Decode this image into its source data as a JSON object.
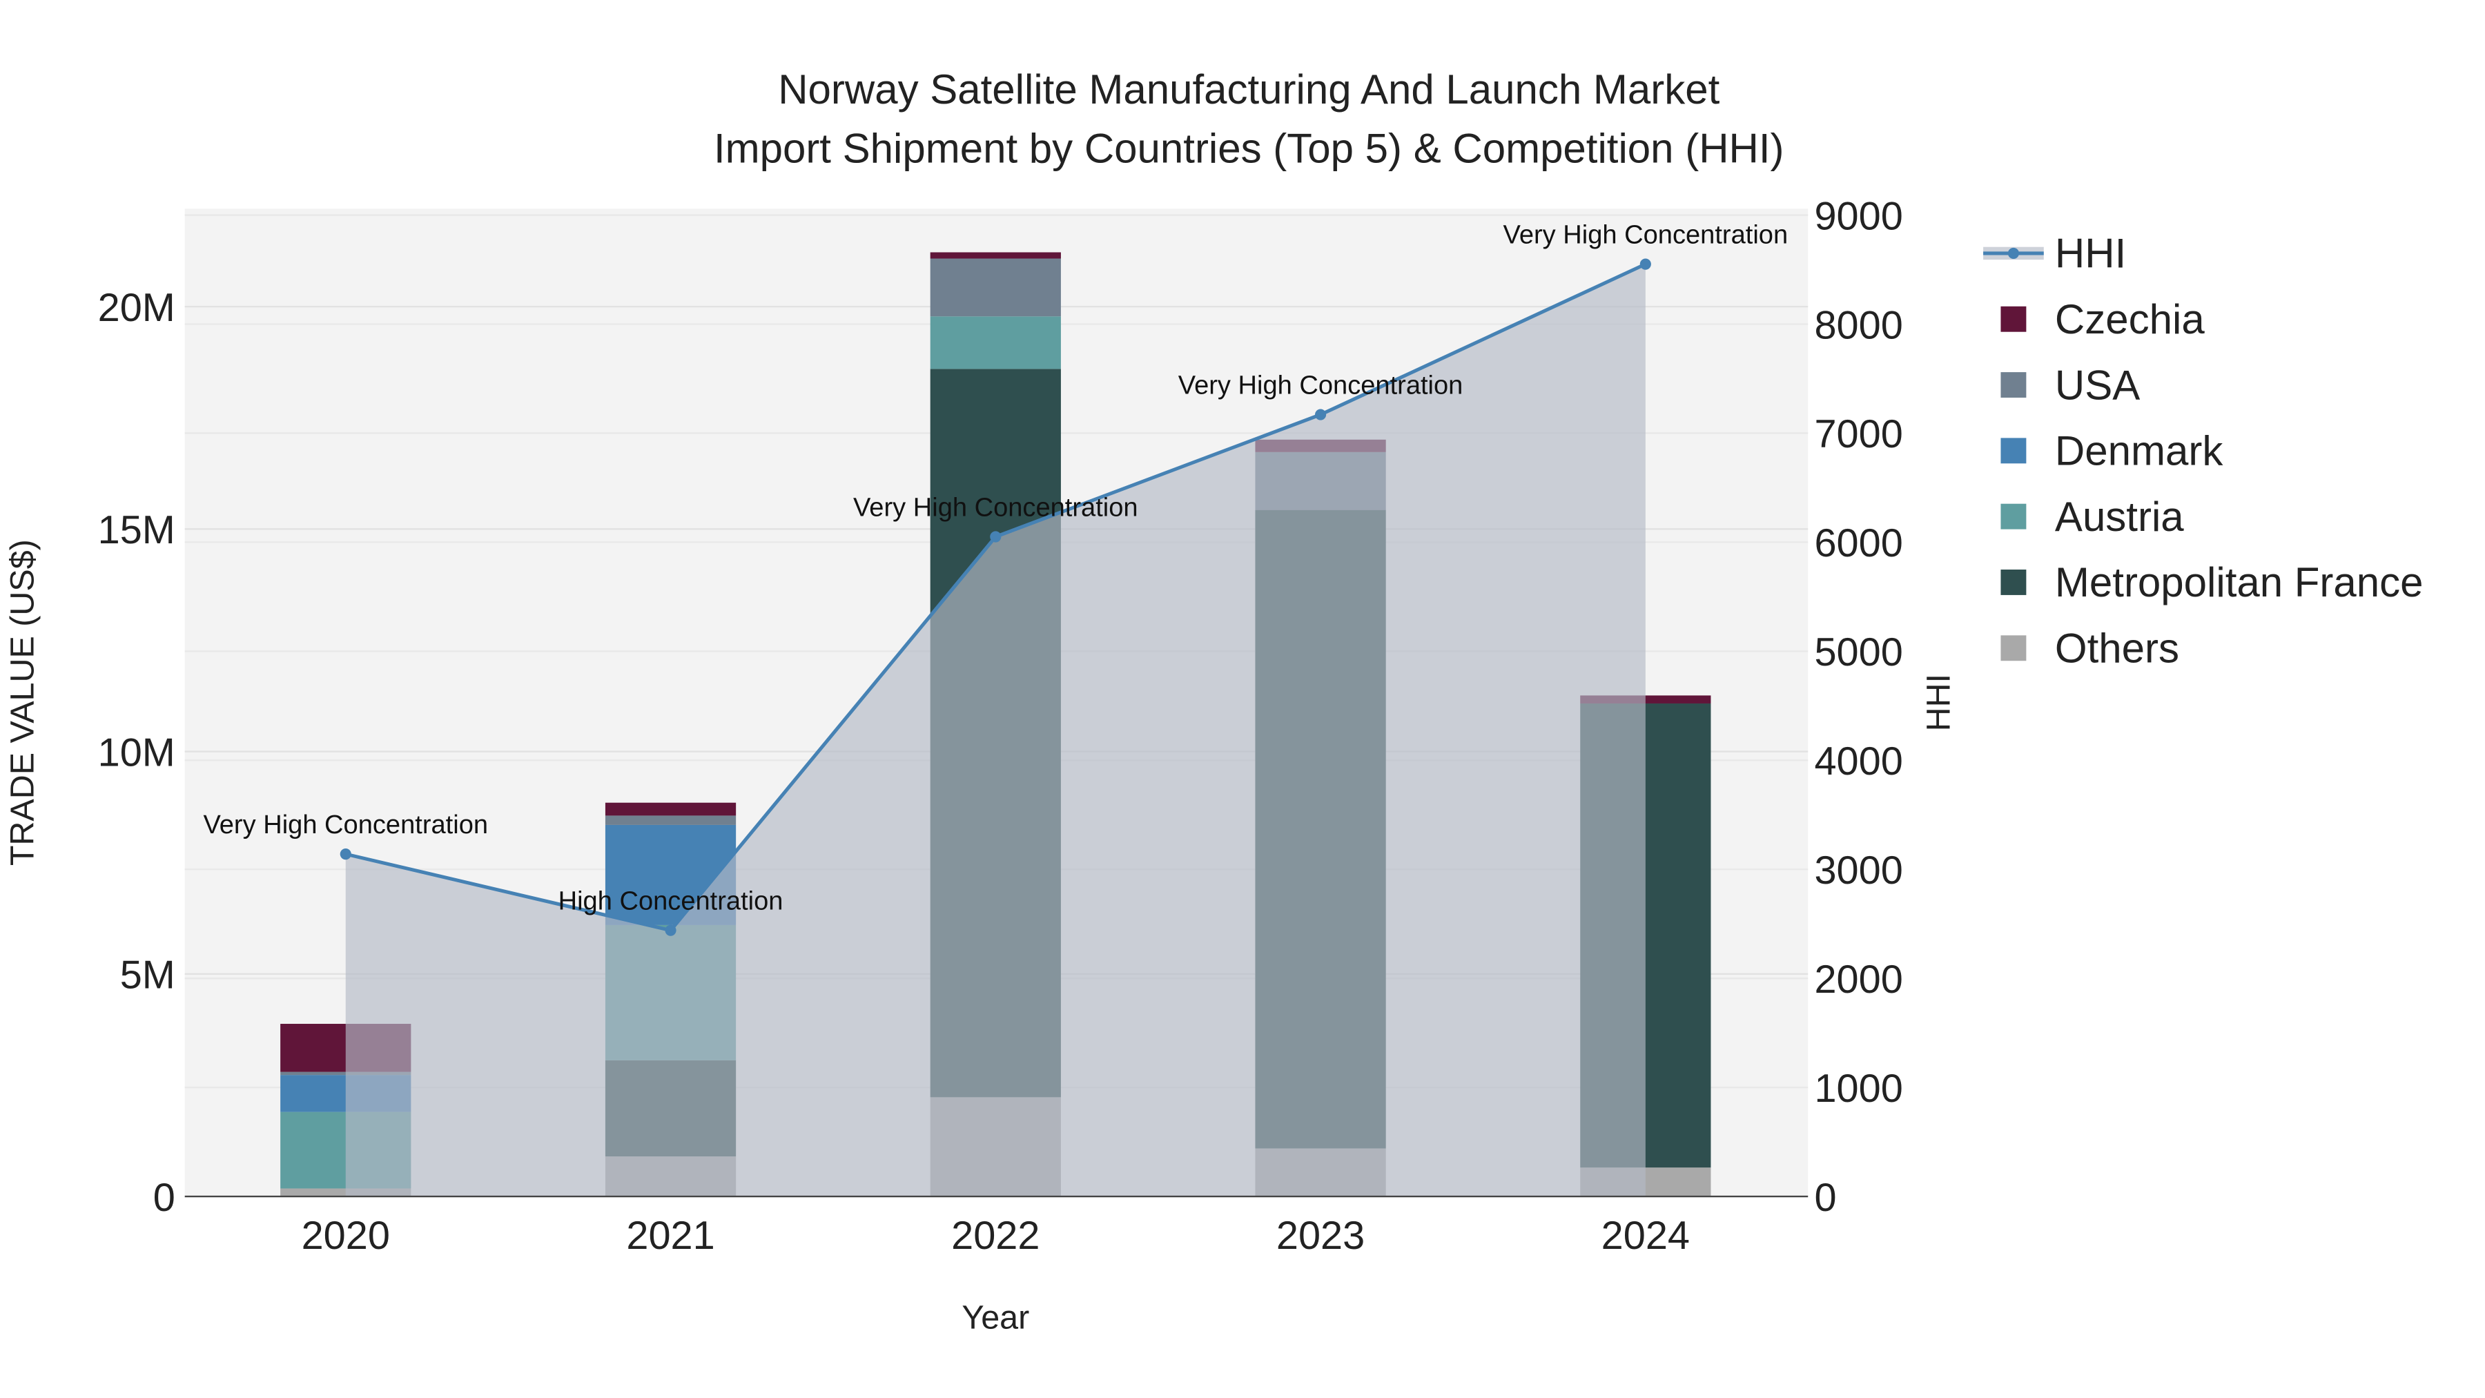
{
  "chart_data": {
    "type": "bar",
    "title_line1": "Norway Satellite Manufacturing And Launch Market",
    "title_line2": "Import Shipment by Countries (Top 5) & Competition (HHI)",
    "xlabel": "Year",
    "ylabel": "TRADE VALUE (US$)",
    "y2label": "HHI",
    "categories": [
      "2020",
      "2021",
      "2022",
      "2023",
      "2024"
    ],
    "ylim": [
      0,
      22200000
    ],
    "y2lim": [
      0,
      9000
    ],
    "yticks": [
      {
        "v": 0,
        "label": "0"
      },
      {
        "v": 5000000,
        "label": "5M"
      },
      {
        "v": 10000000,
        "label": "10M"
      },
      {
        "v": 15000000,
        "label": "15M"
      },
      {
        "v": 20000000,
        "label": "20M"
      }
    ],
    "y2ticks": [
      0,
      1000,
      2000,
      3000,
      4000,
      5000,
      6000,
      7000,
      8000,
      9000
    ],
    "stacked": true,
    "series": [
      {
        "name": "Others",
        "color": "#a9a9a9",
        "values": [
          180000,
          900000,
          2230000,
          1080000,
          650000
        ]
      },
      {
        "name": "Metropolitan France",
        "color": "#2f4f4f",
        "values": [
          0,
          2160000,
          16370000,
          14350000,
          10430000
        ]
      },
      {
        "name": "Austria",
        "color": "#5f9ea0",
        "values": [
          1720000,
          3040000,
          1180000,
          0,
          0
        ]
      },
      {
        "name": "Denmark",
        "color": "#4682b4",
        "values": [
          830000,
          2250000,
          0,
          0,
          0
        ]
      },
      {
        "name": "USA",
        "color": "#708090",
        "values": [
          70000,
          210000,
          1300000,
          1300000,
          0
        ]
      },
      {
        "name": "Czechia",
        "color": "#601539",
        "values": [
          1080000,
          290000,
          140000,
          280000,
          180000
        ]
      }
    ],
    "hhi": {
      "name": "HHI",
      "color": "#4682b4",
      "values": [
        3140,
        2440,
        6050,
        7170,
        8550
      ],
      "annotations": [
        "Very High Concentration",
        "High Concentration",
        "Very High Concentration",
        "Very High Concentration",
        "Very High Concentration"
      ]
    },
    "legend": [
      "HHI",
      "Czechia",
      "USA",
      "Denmark",
      "Austria",
      "Metropolitan France",
      "Others"
    ],
    "legend_position": "right",
    "grid": true
  }
}
